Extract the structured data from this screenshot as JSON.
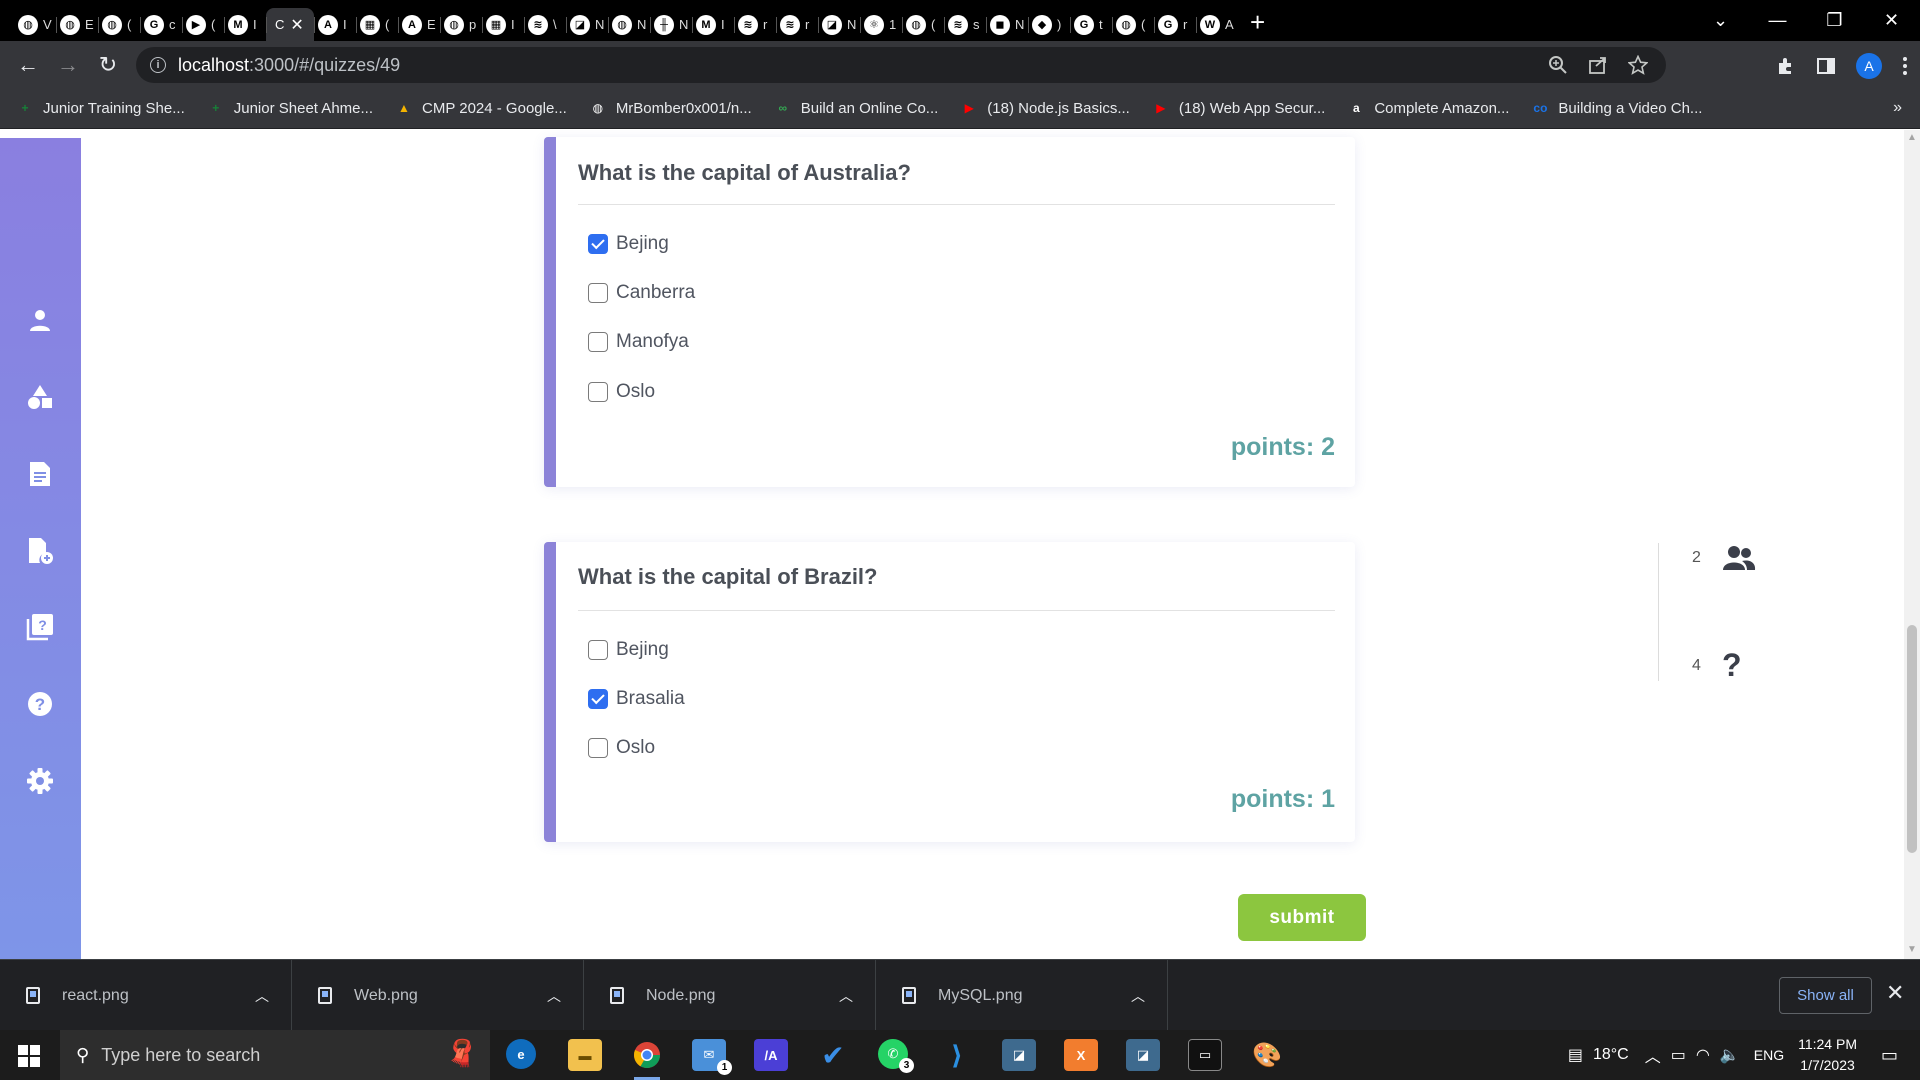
{
  "browser": {
    "tabs": [
      {
        "initial": "◍",
        "text": "V"
      },
      {
        "initial": "◍",
        "text": "E"
      },
      {
        "initial": "◍",
        "text": "("
      },
      {
        "initial": "G",
        "text": "c"
      },
      {
        "initial": "▶",
        "text": "("
      },
      {
        "initial": "M",
        "text": "I"
      },
      {
        "initial": "",
        "text": "C",
        "active": true
      },
      {
        "initial": "A",
        "text": "I"
      },
      {
        "initial": "▦",
        "text": "("
      },
      {
        "initial": "A",
        "text": "E"
      },
      {
        "initial": "◍",
        "text": "p"
      },
      {
        "initial": "▦",
        "text": "I"
      },
      {
        "initial": "≋",
        "text": "\\"
      },
      {
        "initial": "◪",
        "text": "N"
      },
      {
        "initial": "◍",
        "text": "N"
      },
      {
        "initial": "╫",
        "text": "N"
      },
      {
        "initial": "M",
        "text": "I"
      },
      {
        "initial": "≋",
        "text": "r"
      },
      {
        "initial": "≋",
        "text": "r"
      },
      {
        "initial": "◪",
        "text": "N"
      },
      {
        "initial": "⚛",
        "text": "1"
      },
      {
        "initial": "◍",
        "text": "("
      },
      {
        "initial": "≋",
        "text": "s"
      },
      {
        "initial": "◼",
        "text": "N"
      },
      {
        "initial": "◆",
        "text": ")"
      },
      {
        "initial": "G",
        "text": "t"
      },
      {
        "initial": "◍",
        "text": "("
      },
      {
        "initial": "G",
        "text": "r"
      },
      {
        "initial": "W",
        "text": "A"
      }
    ],
    "active_tab_close": "✕",
    "new_tab": "+",
    "window_controls": {
      "dropdown": "⌄",
      "minimize": "—",
      "restore": "❐",
      "close": "✕"
    },
    "nav": {
      "back": "←",
      "forward": "→",
      "reload": "↻"
    },
    "url_host": "localhost",
    "url_path": ":3000/#/quizzes/49",
    "profile_initial": "A",
    "bookmarks": [
      {
        "icon": "+",
        "color": "#188038",
        "label": "Junior Training She..."
      },
      {
        "icon": "+",
        "color": "#188038",
        "label": "Junior Sheet Ahme..."
      },
      {
        "icon": "▲",
        "color": "#f4b400",
        "label": "CMP 2024 - Google..."
      },
      {
        "icon": "◍",
        "color": "#ffffff",
        "label": "MrBomber0x001/n..."
      },
      {
        "icon": "∞",
        "color": "#34a853",
        "label": "Build an Online Co..."
      },
      {
        "icon": "▶",
        "color": "#ff0000",
        "label": "(18) Node.js Basics..."
      },
      {
        "icon": "▶",
        "color": "#ff0000",
        "label": "(18) Web App Secur..."
      },
      {
        "icon": "a",
        "color": "#ffffff",
        "label": "Complete Amazon..."
      },
      {
        "icon": "co",
        "color": "#1a73e8",
        "label": "Building a Video Ch..."
      }
    ],
    "bookmarks_more": "»"
  },
  "questions": [
    {
      "title": "What is the capital of Australia?",
      "options": [
        {
          "label": "Bejing",
          "checked": true
        },
        {
          "label": "Canberra",
          "checked": false
        },
        {
          "label": "Manofya",
          "checked": false
        },
        {
          "label": "Oslo",
          "checked": false
        }
      ],
      "points_text": "points: 2"
    },
    {
      "title": "What is the capital of Brazil?",
      "options": [
        {
          "label": "Bejing",
          "checked": false
        },
        {
          "label": "Brasalia",
          "checked": true
        },
        {
          "label": "Oslo",
          "checked": false
        }
      ],
      "points_text": "points: 1"
    }
  ],
  "submit_label": "submit",
  "stats": {
    "participants": "2",
    "questions": "4",
    "question_glyph": "?"
  },
  "downloads": [
    {
      "name": "react.png"
    },
    {
      "name": "Web.png"
    },
    {
      "name": "Node.png"
    },
    {
      "name": "MySQL.png"
    }
  ],
  "downloads_show_all": "Show all",
  "downloads_close": "✕",
  "taskbar": {
    "search_placeholder": "Type here to search",
    "mail_badge": "1",
    "whatsapp_badge": "3",
    "temperature": "18°C",
    "language": "ENG",
    "time": "11:24 PM",
    "date": "1/7/2023"
  },
  "colors": {
    "sidebar_top": "#8a7fe0",
    "sidebar_bottom": "#7e95e8",
    "card_accent": "#8c83d8",
    "points": "#5ea3a3",
    "submit": "#8cc63f",
    "checkbox_checked": "#2e6ef0"
  }
}
